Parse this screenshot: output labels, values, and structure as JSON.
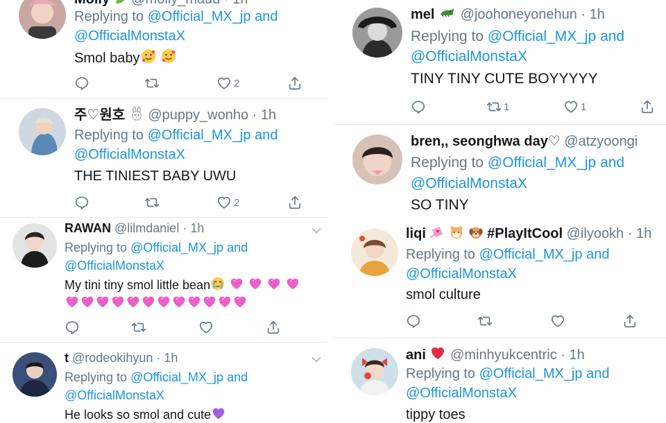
{
  "reply_prefix": "Replying to",
  "reply_and": "and",
  "mention_1": "@Official_MX_jp",
  "mention_2": "@OfficialMonstaX",
  "left": [
    {
      "name": "Molly",
      "handle": "@molly_maud",
      "time": "1h",
      "text": "Smol baby",
      "replies": "",
      "retweets": "",
      "likes": "2"
    },
    {
      "name": "주♡원호",
      "handle": "@puppy_wonho",
      "time": "1h",
      "text": "THE TINIEST BABY UWU",
      "replies": "",
      "retweets": "",
      "likes": "2"
    },
    {
      "name": "RAWAN",
      "handle": "@lilmdaniel",
      "time": "1h",
      "text": "My tini tiny smol little bean",
      "replies": "",
      "retweets": "",
      "likes": ""
    },
    {
      "name": "t",
      "handle": "@rodeokihyun",
      "time": "1h",
      "text": "He looks so smol and cute",
      "replies": "",
      "retweets": "",
      "likes": ""
    }
  ],
  "right": [
    {
      "name": "mel",
      "handle": "@joohoneyonehun",
      "time": "1h",
      "text": "TINY TINY CUTE BOYYYYY",
      "replies": "",
      "retweets": "1",
      "likes": "1"
    },
    {
      "name": "bren,, seonghwa day♡",
      "handle": "@atzyoongi",
      "time": "",
      "text": "SO TINY",
      "replies": "",
      "retweets": "",
      "likes": ""
    },
    {
      "name": "liqi",
      "name_suffix": "#PlayItCool",
      "handle": "@ilyookh",
      "time": "1h",
      "text": "smol culture",
      "replies": "",
      "retweets": "",
      "likes": ""
    },
    {
      "name": "ani",
      "handle": "@minhyukcentric",
      "time": "1h",
      "text": "tippy toes",
      "replies": "",
      "retweets": "",
      "likes": ""
    }
  ],
  "colors": {
    "link": "#1b95e0",
    "muted": "#657786",
    "text": "#14171a",
    "separator": "#e1e8ed"
  },
  "icons": [
    "reply-icon",
    "retweet-icon",
    "like-icon",
    "share-icon",
    "chevron-down-icon"
  ]
}
